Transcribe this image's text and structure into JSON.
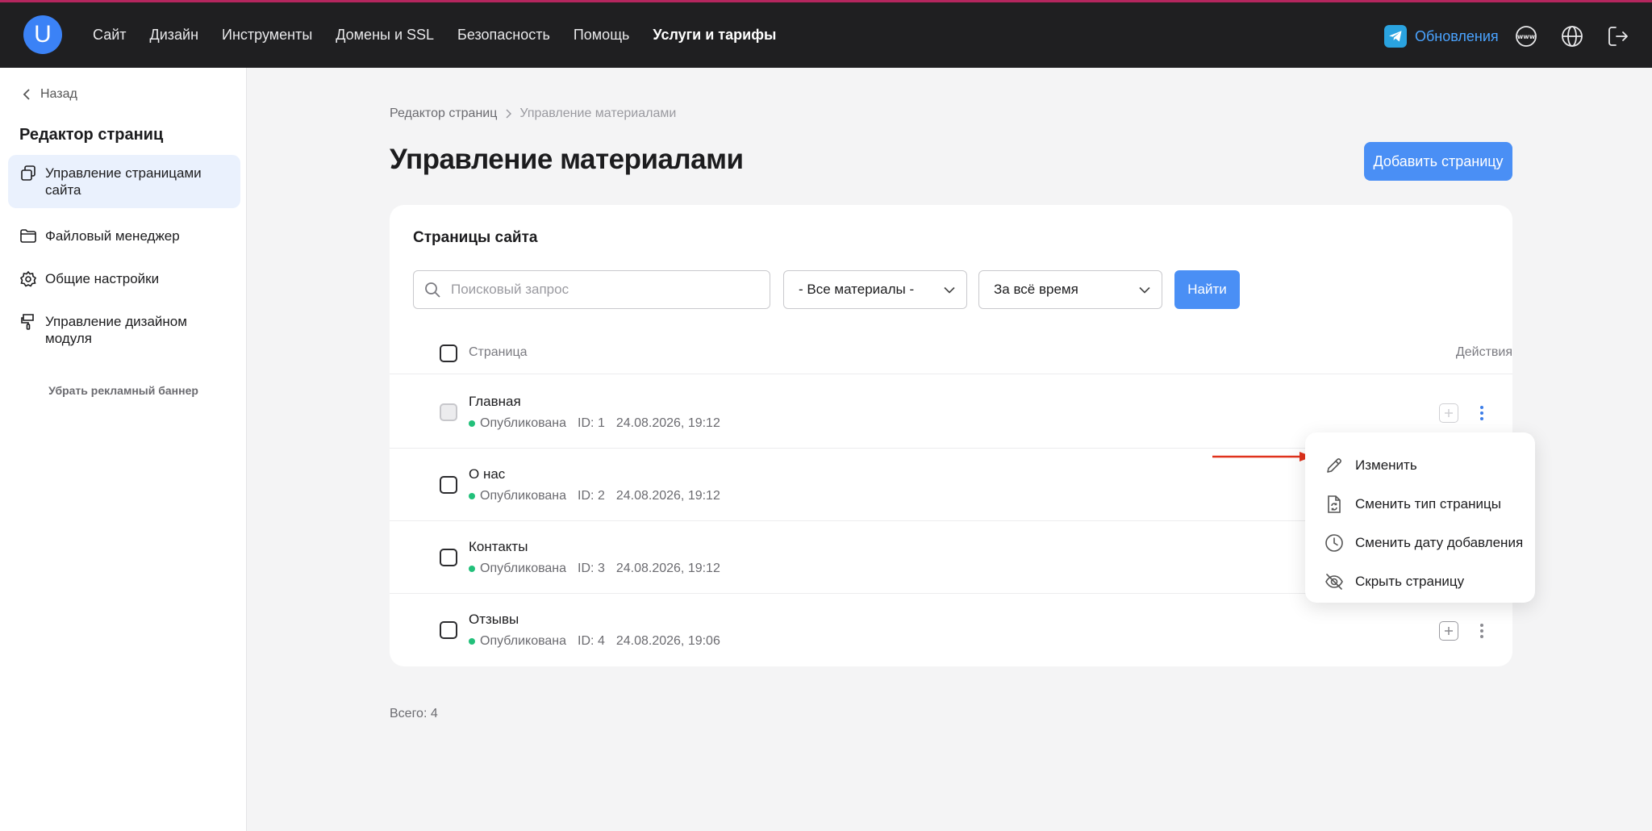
{
  "topnav": {
    "logo_letter": "U",
    "items": [
      "Сайт",
      "Дизайн",
      "Инструменты",
      "Домены и SSL",
      "Безопасность",
      "Помощь",
      "Услуги и тарифы"
    ],
    "updates_label": "Обновления",
    "icons": [
      "telegram-icon",
      "www-icon",
      "globe-icon",
      "logout-icon"
    ]
  },
  "sidebar": {
    "back_label": "Назад",
    "title": "Редактор страниц",
    "items": [
      {
        "label": "Управление страницами сайта",
        "icon": "pages-icon",
        "active": true
      },
      {
        "label": "Файловый менеджер",
        "icon": "folder-icon"
      },
      {
        "label": "Общие настройки",
        "icon": "settings-icon"
      },
      {
        "label": "Управление дизайном модуля",
        "icon": "brush-icon"
      }
    ],
    "remove_banner_link": "Убрать рекламный баннер"
  },
  "breadcrumb": {
    "parent": "Редактор страниц",
    "current": "Управление материалами"
  },
  "page": {
    "title": "Управление материалами",
    "add_button": "Добавить страницу"
  },
  "card": {
    "title": "Страницы сайта",
    "search_placeholder": "Поисковый запрос",
    "filter_materials": "- Все материалы -",
    "filter_period": "За всё время",
    "find_button": "Найти",
    "col_page": "Страница",
    "col_actions": "Действия",
    "rows": [
      {
        "name": "Главная",
        "status": "Опубликована",
        "id": "ID: 1",
        "date": "24.08.2026, 19:12"
      },
      {
        "name": "О нас",
        "status": "Опубликована",
        "id": "ID: 2",
        "date": "24.08.2026, 19:12"
      },
      {
        "name": "Контакты",
        "status": "Опубликована",
        "id": "ID: 3",
        "date": "24.08.2026, 19:12"
      },
      {
        "name": "Отзывы",
        "status": "Опубликована",
        "id": "ID: 4",
        "date": "24.08.2026, 19:06"
      }
    ]
  },
  "total_label": "Всего: 4",
  "context_menu": {
    "items": [
      {
        "label": "Изменить",
        "icon": "pencil-icon"
      },
      {
        "label": "Сменить тип страницы",
        "icon": "file-refresh-icon"
      },
      {
        "label": "Сменить дату добавления",
        "icon": "clock-icon"
      },
      {
        "label": "Скрыть страницу",
        "icon": "eye-off-icon"
      }
    ]
  },
  "colors": {
    "accent": "#4a8ff5",
    "topbar": "#1f1f21",
    "topbar_border": "#b4265e",
    "status_published": "#22c07a",
    "annotation_arrow": "#e0321c"
  }
}
